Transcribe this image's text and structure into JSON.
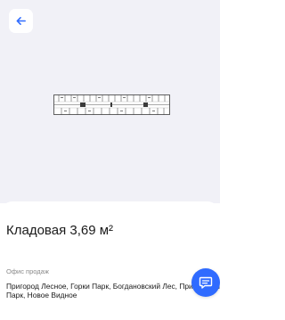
{
  "unit": {
    "title": "Кладовая 3,69 м²"
  },
  "sales_office": {
    "label": "Офис продаж",
    "complexes": "Пригород Лесное, Горки Парк, Богдановский Лес, Прибрежный Парк, Новое Видное"
  },
  "icons": {
    "back": "arrow-left-icon",
    "chat": "chat-bubble-icon",
    "floor_plan": "floor-plan-image"
  },
  "colors": {
    "accent": "#2f6bff",
    "media_background": "#f1f1f7"
  }
}
